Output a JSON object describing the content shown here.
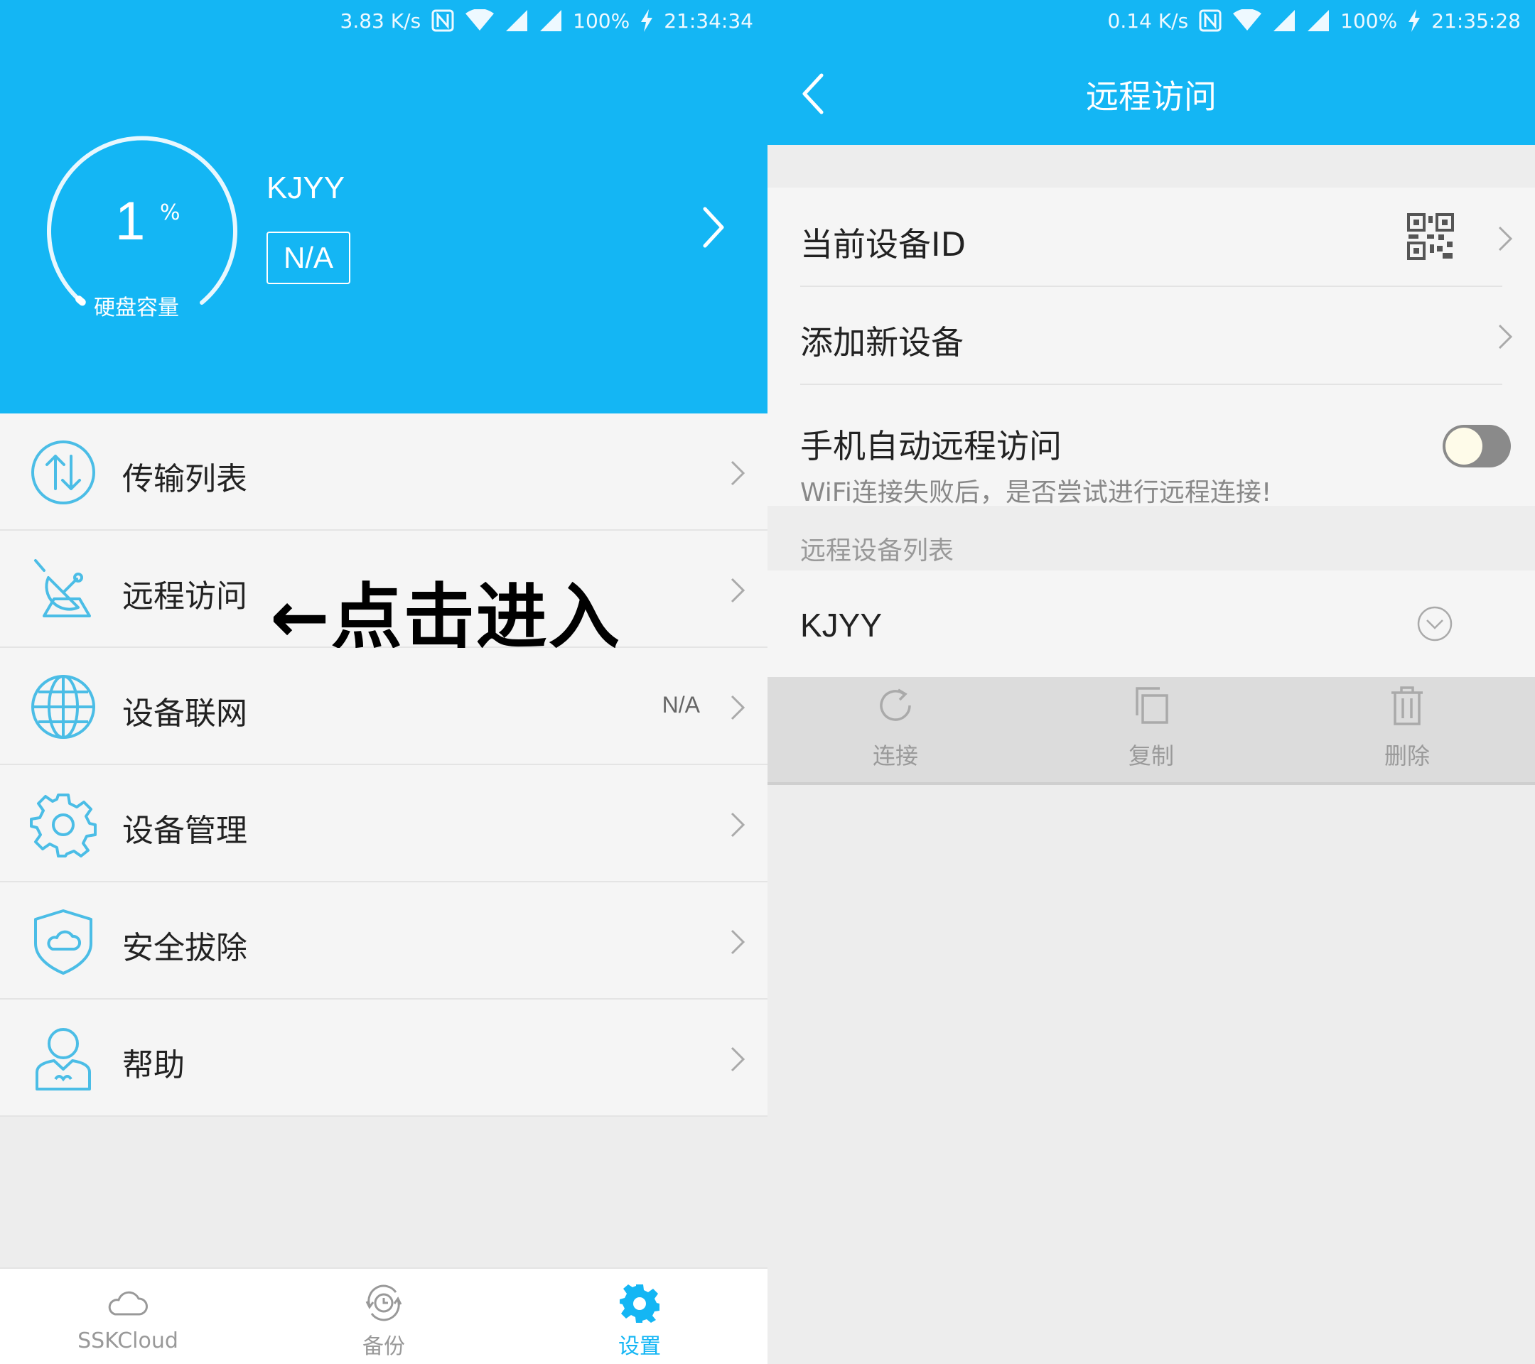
{
  "left_screen": {
    "status_bar": {
      "speed": "3.83 K/s",
      "battery": "100%",
      "time": "21:34:34"
    },
    "disk": {
      "value": "1",
      "unit": "%",
      "label": "硬盘容量",
      "level_percent": 1
    },
    "device": {
      "name": "KJYY",
      "badge": "N/A"
    },
    "menu": [
      {
        "label": "传输列表",
        "icon": "transfer-icon",
        "value": ""
      },
      {
        "label": "远程访问",
        "icon": "satellite-dish-icon",
        "value": ""
      },
      {
        "label": "设备联网",
        "icon": "globe-icon",
        "value": "N/A"
      },
      {
        "label": "设备管理",
        "icon": "gear-icon",
        "value": ""
      },
      {
        "label": "安全拔除",
        "icon": "shield-cloud-icon",
        "value": ""
      },
      {
        "label": "帮助",
        "icon": "person-icon",
        "value": ""
      }
    ],
    "annotation": "←点击进入",
    "tabs": [
      {
        "label": "SSKCloud",
        "icon": "cloud-icon",
        "active": false
      },
      {
        "label": "备份",
        "icon": "backup-clock-icon",
        "active": false
      },
      {
        "label": "设置",
        "icon": "settings-gear-icon",
        "active": true
      }
    ],
    "colors": {
      "accent": "#14b6f4",
      "background": "#ededed"
    }
  },
  "right_screen": {
    "status_bar": {
      "speed": "0.14 K/s",
      "battery": "100%",
      "time": "21:35:28"
    },
    "title": "远程访问",
    "rows": {
      "current_device_id": "当前设备ID",
      "add_device": "添加新设备",
      "auto_remote": "手机自动远程访问",
      "auto_remote_desc": "WiFi连接失败后，是否尝试进行远程连接!",
      "auto_remote_enabled": false
    },
    "section_title": "远程设备列表",
    "remote_device": "KJYY",
    "actions": [
      {
        "label": "连接",
        "icon": "refresh-icon"
      },
      {
        "label": "复制",
        "icon": "copy-icon"
      },
      {
        "label": "删除",
        "icon": "trash-icon"
      }
    ]
  }
}
